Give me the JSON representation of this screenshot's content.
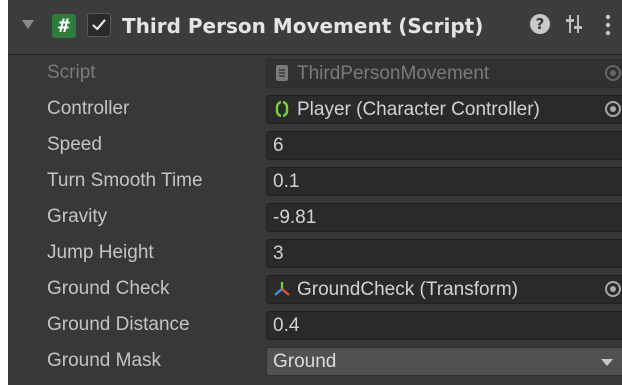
{
  "component": {
    "title": "Third Person Movement (Script)",
    "enabled": true,
    "icons": {
      "script": "#",
      "help": "?",
      "preset": "preset-icon",
      "menu": "kebab-menu-icon"
    }
  },
  "fields": {
    "script": {
      "label": "Script",
      "value": "ThirdPersonMovement"
    },
    "controller": {
      "label": "Controller",
      "value": "Player (Character Controller)"
    },
    "speed": {
      "label": "Speed",
      "value": "6"
    },
    "turn_smooth_time": {
      "label": "Turn Smooth Time",
      "value": "0.1"
    },
    "gravity": {
      "label": "Gravity",
      "value": "-9.81"
    },
    "jump_height": {
      "label": "Jump Height",
      "value": "3"
    },
    "ground_check": {
      "label": "Ground Check",
      "value": "GroundCheck (Transform)"
    },
    "ground_distance": {
      "label": "Ground Distance",
      "value": "0.4"
    },
    "ground_mask": {
      "label": "Ground Mask",
      "value": "Ground"
    }
  },
  "colors": {
    "panel_bg": "#383838",
    "field_bg": "#2a2a2a",
    "script_icon_green": "#2e7d3c",
    "controller_icon_green": "#7bd23a"
  }
}
